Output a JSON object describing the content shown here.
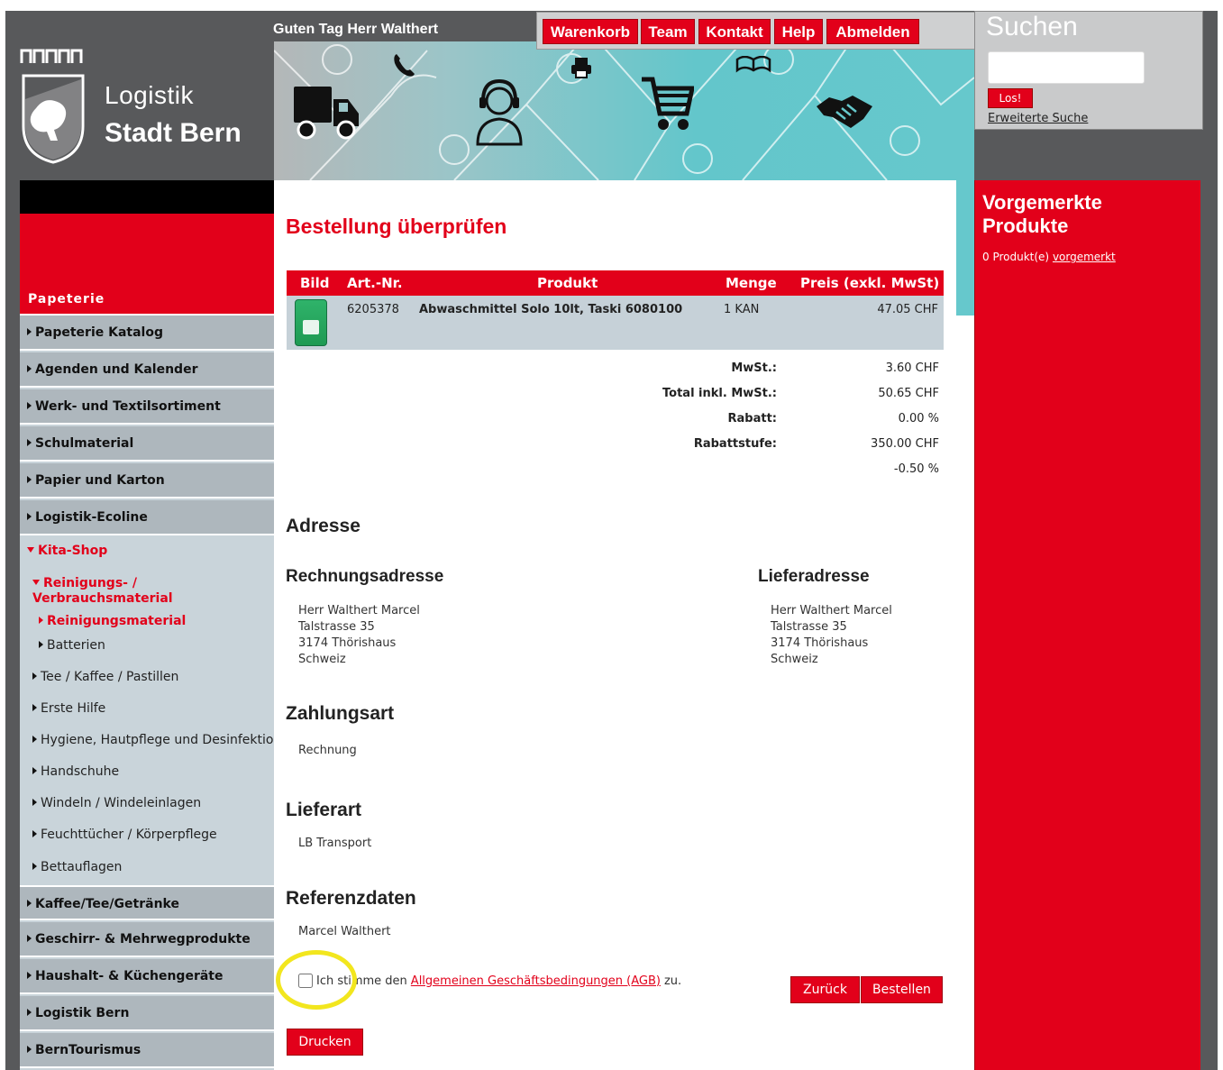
{
  "header": {
    "logo_line1": "Logistik",
    "logo_line2": "Stadt Bern",
    "greeting": "Guten Tag Herr Walthert"
  },
  "topnav": [
    "Warenkorb",
    "Team",
    "Kontakt",
    "Help",
    "Abmelden"
  ],
  "search": {
    "title": "Suchen",
    "placeholder": "",
    "go_label": "Los!",
    "advanced_label": "Erweiterte Suche"
  },
  "sidebar": {
    "heading": "Papeterie",
    "items": [
      "Papeterie Katalog",
      "Agenden und Kalender",
      "Werk- und Textilsortiment",
      "Schulmaterial",
      "Papier und Karton",
      "Logistik-Ecoline"
    ],
    "kita": {
      "label": "Kita-Shop",
      "reinigung": "Reinigungs- /",
      "reinigung2": "Verbrauchsmaterial",
      "sub_active": "Reinigungsmaterial",
      "sub_batterien": "Batterien",
      "subitems": [
        "Tee / Kaffee / Pastillen",
        "Erste Hilfe",
        "Hygiene, Hautpflege und Desinfektion",
        "Handschuhe",
        "Windeln / Windeleinlagen",
        "Feuchttücher / Körperpflege",
        "Bettauflagen"
      ]
    },
    "bottom_items": [
      "Kaffee/Tee/Getränke",
      "Geschirr- & Mehrwegprodukte",
      "Haushalt- & Küchengeräte",
      "Logistik Bern",
      "BernTourismus"
    ]
  },
  "main": {
    "title": "Bestellung überprüfen",
    "table": {
      "headers": [
        "Bild",
        "Art.-Nr.",
        "Produkt",
        "Menge",
        "Preis (exkl. MwSt)"
      ],
      "row": {
        "art_nr": "6205378",
        "produkt": "Abwaschmittel Solo 10lt, Taski 6080100",
        "menge": "1 KAN",
        "preis": "47.05 CHF"
      }
    },
    "totals": [
      {
        "label": "MwSt.:",
        "value": "3.60 CHF"
      },
      {
        "label": "Total inkl. MwSt.:",
        "value": "50.65 CHF"
      },
      {
        "label": "Rabatt:",
        "value": "0.00 %"
      },
      {
        "label": "Rabattstufe:",
        "value": "350.00 CHF"
      },
      {
        "label": "",
        "value": "-0.50 %"
      }
    ],
    "adresse_heading": "Adresse",
    "rechnung_heading": "Rechnungsadresse",
    "liefer_heading": "Lieferadresse",
    "rechnung_lines": [
      "Herr Walthert Marcel",
      "Talstrasse 35",
      "3174 Thörishaus",
      "Schweiz"
    ],
    "liefer_lines": [
      "Herr Walthert Marcel",
      "Talstrasse 35",
      "3174 Thörishaus",
      "Schweiz"
    ],
    "zahlungsart_heading": "Zahlungsart",
    "zahlungsart": "Rechnung",
    "lieferart_heading": "Lieferart",
    "lieferart": "LB Transport",
    "referenz_heading": "Referenzdaten",
    "referenz": "Marcel Walthert",
    "agb_pre": "Ich stimme den",
    "agb_link": "Allgemeinen Geschäftsbedingungen (AGB)",
    "agb_post": "zu.",
    "btn_back": "Zurück",
    "btn_order": "Bestellen",
    "btn_print": "Drucken"
  },
  "right": {
    "title": "Vorgemerkte Produkte",
    "info_pre": "0 Produkt(e)",
    "info_link": "vorgemerkt"
  },
  "colors": {
    "accent": "#e2001a",
    "dark_gray": "#58595b",
    "teal": "#66c8cc",
    "row_bg": "#c6d1d8",
    "highlight_circle": "#f2e61e"
  }
}
